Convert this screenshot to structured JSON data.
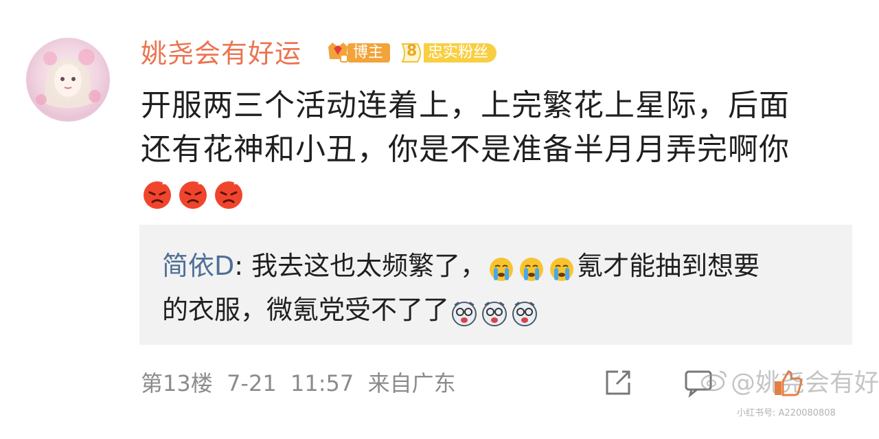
{
  "comment": {
    "username": "姚尧会有好运",
    "badges": {
      "blogger_label": "博主",
      "fan_level": "8",
      "fan_label": "忠实粉丝"
    },
    "text_lines": [
      "开服两三个活动连着上，上完繁花上星际，后面",
      "还有花神和小丑，你是不是准备半月月弄完啊你"
    ],
    "emojis": [
      "angry-face-icon",
      "angry-face-icon",
      "angry-face-icon"
    ]
  },
  "reply": {
    "user": "简依D",
    "separator": ": ",
    "line1_part1": "我去这也太频繁了，",
    "line1_emojis": [
      "crying-face-icon",
      "crying-face-icon",
      "crying-face-icon"
    ],
    "line1_part2": "氪才能抽到想要",
    "line2": "的衣服，微氪党受不了了",
    "line2_emojis": [
      "dizzy-face-icon",
      "dizzy-face-icon",
      "dizzy-face-icon"
    ]
  },
  "meta": {
    "info": "第13楼  7-21  11:57  来自广东"
  },
  "watermark": {
    "weibo": "@姚尧会有好运",
    "xhs": "小红书号: A220080808"
  },
  "colors": {
    "username": "#eb7350",
    "reply_user": "#4f6f96",
    "reply_bg": "#f2f2f2",
    "meta": "#8b8b8b"
  }
}
